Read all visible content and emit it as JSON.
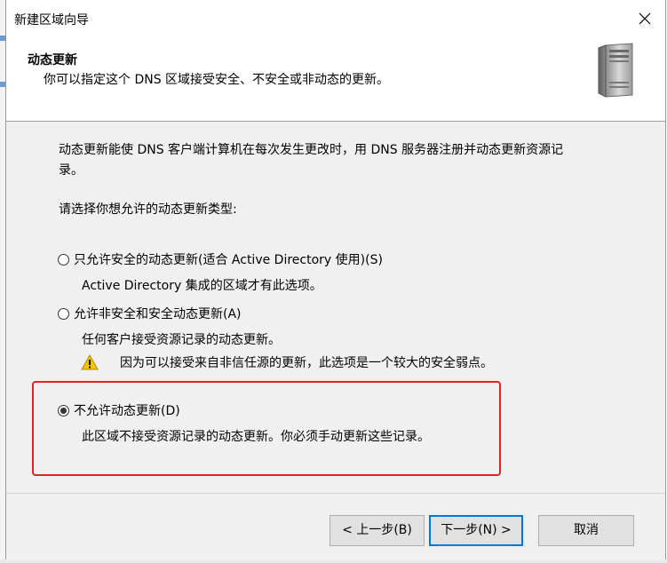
{
  "window": {
    "title": "新建区域向导",
    "close_glyph": "✕"
  },
  "header": {
    "title": "动态更新",
    "subtitle": "你可以指定这个 DNS 区域接受安全、不安全或非动态的更新。",
    "icon": "server-tower-icon"
  },
  "content": {
    "intro_line1": "动态更新能使 DNS 客户端计算机在每次发生更改时，用 DNS 服务器注册并动态更新资源记",
    "intro_line2": "录。",
    "prompt": "请选择你想允许的动态更新类型:",
    "options": [
      {
        "label": "只允许安全的动态更新(适合 Active Directory 使用)(S)",
        "description": "Active Directory 集成的区域才有此选项。",
        "checked": false
      },
      {
        "label": "允许非安全和安全动态更新(A)",
        "description": "任何客户接受资源记录的动态更新。",
        "warning": "因为可以接受来自非信任源的更新，此选项是一个较大的安全弱点。",
        "checked": false
      },
      {
        "label": "不允许动态更新(D)",
        "description": "此区域不接受资源记录的动态更新。你必须手动更新这些记录。",
        "checked": true
      }
    ]
  },
  "footer": {
    "back_label": "< 上一步(B)",
    "next_label": "下一步(N) >",
    "cancel_label": "取消"
  },
  "colors": {
    "highlight_border": "#e8231f",
    "primary_button_border": "#0078d7",
    "content_background": "#f0f0f0",
    "warning_yellow": "#f5c400"
  }
}
